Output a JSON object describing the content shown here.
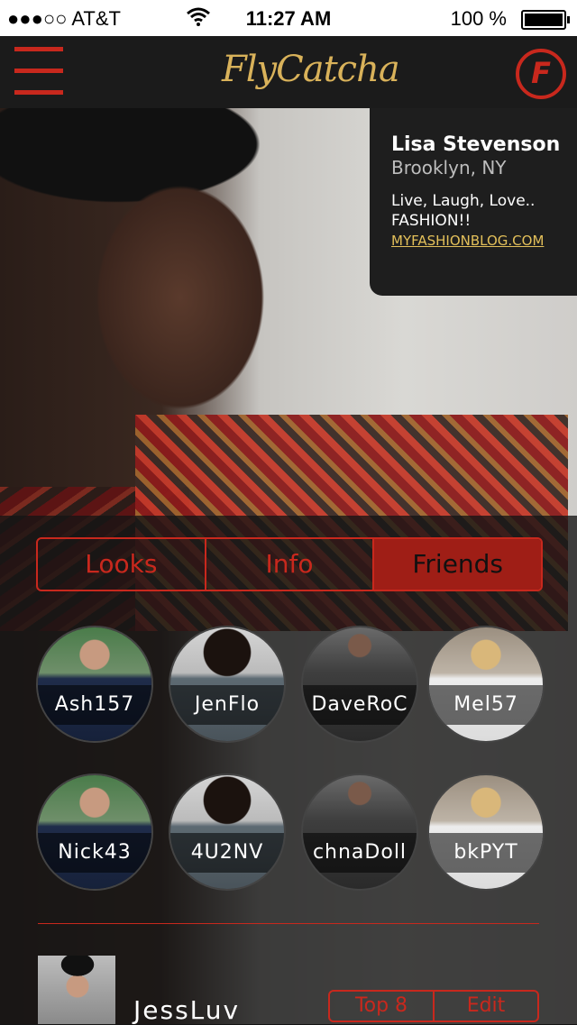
{
  "status_bar": {
    "carrier": "●●●○○ AT&T",
    "time": "11:27 AM",
    "battery": "100 %"
  },
  "header": {
    "logo": "FlyCatcha",
    "profile_icon_letter": "F"
  },
  "profile": {
    "name": "Lisa Stevenson",
    "location": "Brooklyn, NY",
    "bio": "Live, Laugh, Love.. FASHION!!",
    "link": "MYFASHIONBLOG.COM"
  },
  "tabs": [
    {
      "label": "Looks",
      "active": false
    },
    {
      "label": "Info",
      "active": false
    },
    {
      "label": "Friends",
      "active": true
    }
  ],
  "friends": [
    {
      "name": "Ash157",
      "photo": "ph1"
    },
    {
      "name": "JenFlo",
      "photo": "ph2"
    },
    {
      "name": "DaveRoC",
      "photo": "ph3"
    },
    {
      "name": "Mel57",
      "photo": "ph4"
    },
    {
      "name": "Nick43",
      "photo": "ph1"
    },
    {
      "name": "4U2NV",
      "photo": "ph2"
    },
    {
      "name": "chnaDoll",
      "photo": "ph3"
    },
    {
      "name": "bkPYT",
      "photo": "ph4"
    }
  ],
  "featured_friend": {
    "name": "JessLuv"
  },
  "actions": {
    "top8": "Top 8",
    "edit": "Edit"
  },
  "colors": {
    "accent": "#c8281d",
    "gold": "#d9b25a"
  }
}
